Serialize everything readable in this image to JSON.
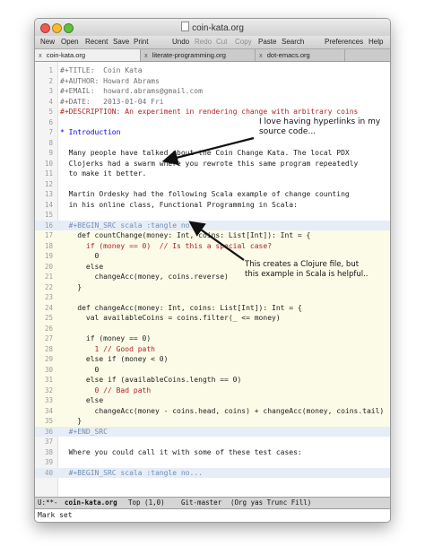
{
  "window": {
    "title": "coin-kata.org"
  },
  "toolbar": {
    "new": "New",
    "open": "Open",
    "recent": "Recent",
    "save": "Save",
    "print": "Print",
    "undo": "Undo",
    "redo": "Redo",
    "cut": "Cut",
    "copy": "Copy",
    "paste": "Paste",
    "search": "Search",
    "preferences": "Preferences",
    "help": "Help"
  },
  "tabs": [
    {
      "label": "coin-kata.org",
      "close": "x",
      "active": true
    },
    {
      "label": "literate-programming.org",
      "close": "x",
      "active": false
    },
    {
      "label": "dot-emacs.org",
      "close": "x",
      "active": false
    }
  ],
  "editor": {
    "lines": [
      {
        "n": "1",
        "t": "#+TITLE:  Coin Kata"
      },
      {
        "n": "2",
        "t": "#+AUTHOR: Howard Abrams"
      },
      {
        "n": "3",
        "t": "#+EMAIL:  howard.abrams@gmail.com"
      },
      {
        "n": "4",
        "t": "#+DATE:   2013-01-04 Fri"
      },
      {
        "n": "5",
        "t": "#+DESCRIPTION: An experiment in rendering change with arbitrary coins"
      },
      {
        "n": "6",
        "t": ""
      },
      {
        "n": "7",
        "t": "* Introduction"
      },
      {
        "n": "8",
        "t": ""
      },
      {
        "n": "9",
        "t": "  Many people have talked about the Coin Change Kata. The local PDX"
      },
      {
        "n": "10",
        "t": "  Clojerks had a swarm where you rewrote this same program repeatedly"
      },
      {
        "n": "11",
        "t": "  to make it better."
      },
      {
        "n": "12",
        "t": ""
      },
      {
        "n": "13",
        "t": "  Martin Ordesky had the following Scala example of change counting"
      },
      {
        "n": "14",
        "t": "  in his online class, Functional Programming in Scala:"
      },
      {
        "n": "15",
        "t": ""
      },
      {
        "n": "16",
        "t": "  #+BEGIN_SRC scala :tangle no"
      },
      {
        "n": "17",
        "t": "    def countChange(money: Int, coins: List[Int]): Int = {"
      },
      {
        "n": "18",
        "t": "      if (money == 0)  // Is this a special case?"
      },
      {
        "n": "19",
        "t": "        0"
      },
      {
        "n": "20",
        "t": "      else"
      },
      {
        "n": "21",
        "t": "        changeAcc(money, coins.reverse)"
      },
      {
        "n": "22",
        "t": "    }"
      },
      {
        "n": "23",
        "t": ""
      },
      {
        "n": "24",
        "t": "    def changeAcc(money: Int, coins: List[Int]): Int = {"
      },
      {
        "n": "25",
        "t": "      val availableCoins = coins.filter(_ <= money)"
      },
      {
        "n": "26",
        "t": ""
      },
      {
        "n": "27",
        "t": "      if (money == 0)"
      },
      {
        "n": "28",
        "t": "        1 // Good path"
      },
      {
        "n": "29",
        "t": "      else if (money < 0)"
      },
      {
        "n": "30",
        "t": "        0"
      },
      {
        "n": "31",
        "t": "      else if (availableCoins.length == 0)"
      },
      {
        "n": "32",
        "t": "        0 // Bad path"
      },
      {
        "n": "33",
        "t": "      else"
      },
      {
        "n": "34",
        "t": "        changeAcc(money - coins.head, coins) + changeAcc(money, coins.tail)"
      },
      {
        "n": "35",
        "t": "    }"
      },
      {
        "n": "36",
        "t": "  #+END_SRC"
      },
      {
        "n": "37",
        "t": ""
      },
      {
        "n": "38",
        "t": "  Where you could call it with some of these test cases:"
      },
      {
        "n": "39",
        "t": ""
      },
      {
        "n": "40",
        "t": "  #+BEGIN_SRC scala :tangle no..."
      }
    ]
  },
  "modeline": {
    "status": "U:**-",
    "buffer": "coin-kata.org",
    "position": "Top (1,0)",
    "vc": "Git-master",
    "modes": "(Org yas Trunc Fill)"
  },
  "minibuffer": {
    "message": "Mark set"
  },
  "callouts": {
    "hyperlinks": [
      "I love having hyperlinks in my",
      "source code..."
    ],
    "clojure": [
      "This creates a Clojure file, but",
      "this example in Scala is helpful.."
    ]
  },
  "colors": {
    "keyword": "#a020f0",
    "comment": "#b22222",
    "type": "#228b22",
    "function": "#0000ff",
    "src_background": "#fbfbe8"
  }
}
